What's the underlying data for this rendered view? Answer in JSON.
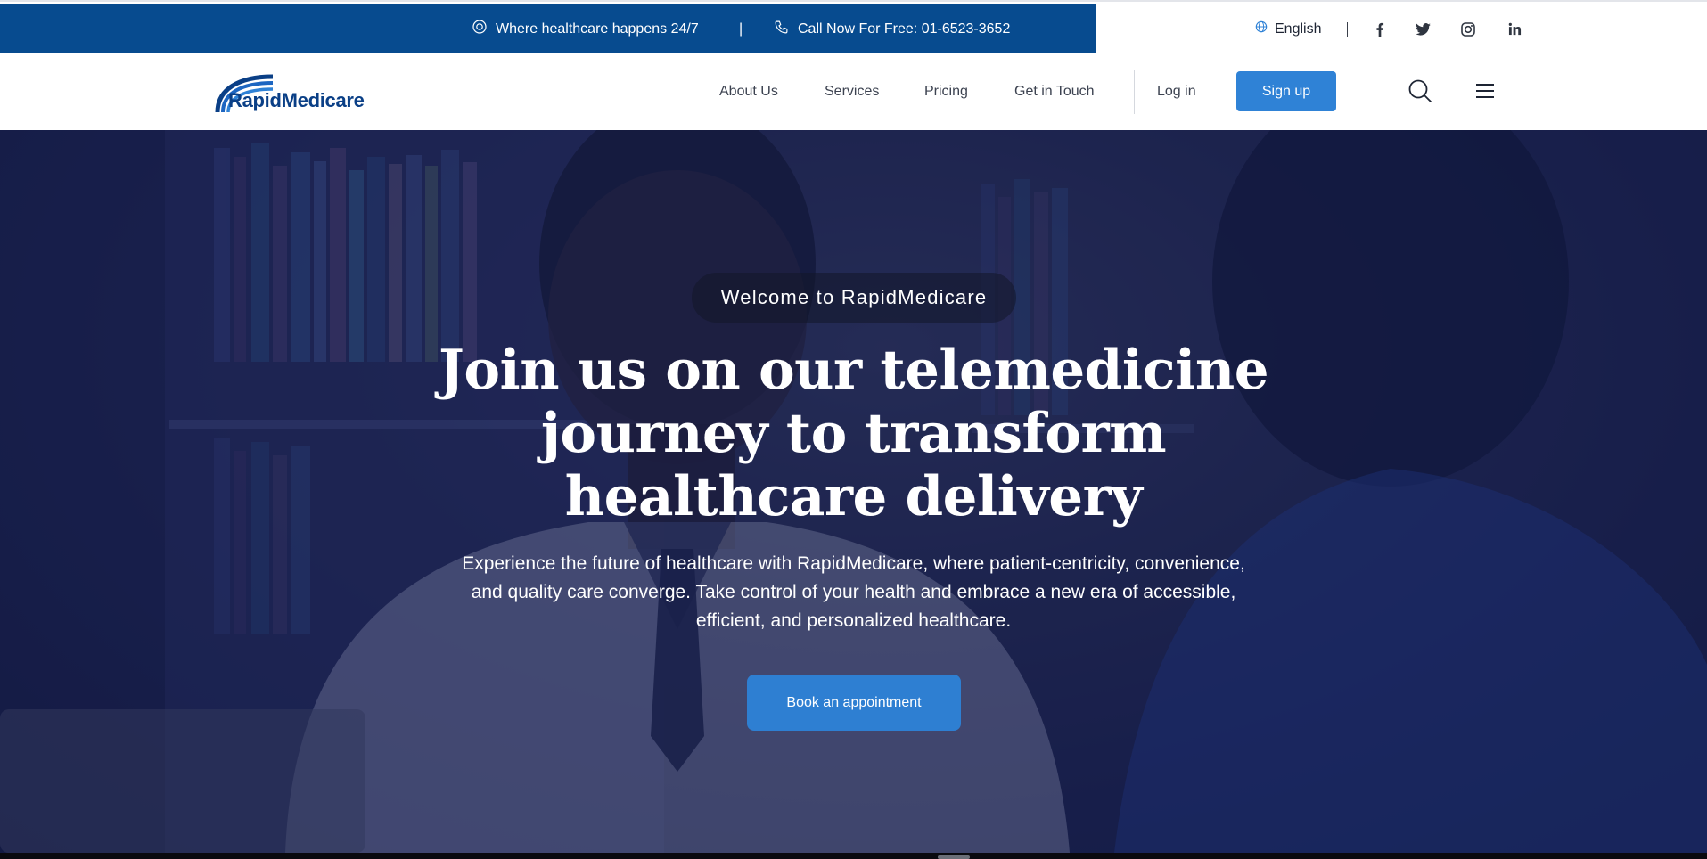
{
  "topbar": {
    "tagline": "Where healthcare happens 24/7",
    "separator": "|",
    "phone": "Call Now For Free: 01-6523-3652",
    "language": "English",
    "social_icons": [
      "facebook-icon",
      "twitter-icon",
      "instagram-icon",
      "linkedin-icon"
    ]
  },
  "nav": {
    "logo_text": "RapidMedicare",
    "links": [
      "About Us",
      "Services",
      "Pricing",
      "Get in Touch"
    ],
    "login": "Log in",
    "signup": "Sign up",
    "icons": [
      "search-icon",
      "menu-icon"
    ]
  },
  "hero": {
    "welcome": "Welcome to RapidMedicare",
    "headline": "Join us on our telemedicine journey to transform healthcare delivery",
    "subtext": "Experience the future of healthcare with RapidMedicare, where patient-centricity, convenience, and quality care converge. Take control of your health and embrace a new era of accessible, efficient, and personalized healthcare.",
    "cta": "Book an appointment"
  },
  "colors": {
    "topbar_blue": "#074b8f",
    "primary_button": "#2f82d6",
    "hero_overlay": "#1b2048",
    "logo_navy": "#0a3f86"
  }
}
